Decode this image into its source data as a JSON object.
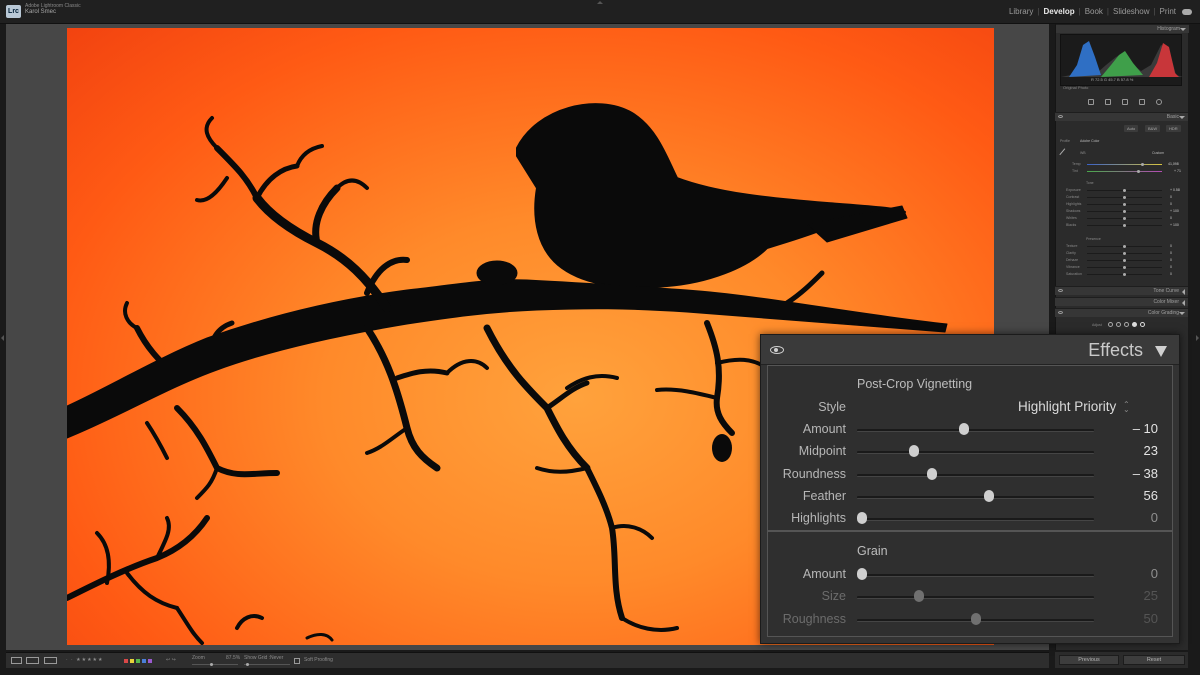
{
  "app": {
    "logo": "Lrc",
    "name": "Adobe Lightroom Classic",
    "user": "Karol Smec"
  },
  "modules": [
    {
      "label": "Library",
      "active": false
    },
    {
      "label": "Develop",
      "active": true
    },
    {
      "label": "Book",
      "active": false
    },
    {
      "label": "Slideshow",
      "active": false
    },
    {
      "label": "Print",
      "active": false
    }
  ],
  "right_panel": {
    "histogram_title": "Histogram",
    "histogram_values": "R  72.5   G  45.7   B  57.8  %",
    "original_photo": "Original Photo",
    "basic_title": "Basic",
    "basic_buttons": [
      "Auto",
      "B&W",
      "HDR"
    ],
    "profile_label": "Profile",
    "profile_value": "Adobe Color",
    "wb_label": "WB",
    "wb_value": "Custom",
    "temp_label": "Temp",
    "temp_value": "41,098",
    "tint_label": "Tint",
    "tint_value": "+ 71",
    "tone_label": "Tone",
    "tone_rows": [
      {
        "label": "Exposure",
        "value": "+ 0.58"
      },
      {
        "label": "Contrast",
        "value": "0"
      },
      {
        "label": "Highlights",
        "value": "0"
      },
      {
        "label": "Shadows",
        "value": "+ 100"
      },
      {
        "label": "Whites",
        "value": "0"
      },
      {
        "label": "Blacks",
        "value": "+ 100"
      }
    ],
    "presence_label": "Presence",
    "presence_rows": [
      {
        "label": "Texture",
        "value": "0"
      },
      {
        "label": "Clarity",
        "value": "0"
      },
      {
        "label": "Dehaze",
        "value": "0"
      },
      {
        "label": "Vibrance",
        "value": "0"
      },
      {
        "label": "Saturation",
        "value": "0"
      }
    ],
    "tone_curve_title": "Tone Curve",
    "color_mixer_title": "Color Mixer",
    "color_grading_title": "Color Grading",
    "adjust_label": "Adjust"
  },
  "effects": {
    "title": "Effects",
    "vignette_title": "Post-Crop Vignetting",
    "style_label": "Style",
    "style_value": "Highlight Priority",
    "vignette_sliders": [
      {
        "label": "Amount",
        "value": "– 10",
        "fraction": 0.45
      },
      {
        "label": "Midpoint",
        "value": "23",
        "fraction": 0.23
      },
      {
        "label": "Roundness",
        "value": "– 38",
        "fraction": 0.31
      },
      {
        "label": "Feather",
        "value": "56",
        "fraction": 0.56
      },
      {
        "label": "Highlights",
        "value": "0",
        "fraction": 0.0
      }
    ],
    "grain_title": "Grain",
    "grain_sliders": [
      {
        "label": "Amount",
        "value": "0",
        "fraction": 0.0
      },
      {
        "label": "Size",
        "value": "25",
        "fraction": 0.25
      },
      {
        "label": "Roughness",
        "value": "50",
        "fraction": 0.5
      }
    ]
  },
  "bottom": {
    "zoom_label": "Zoom",
    "zoom_value": "87.5%",
    "show_grid_label": "Show Grid :",
    "show_grid_value": "Never",
    "soft_proofing": "Soft Proofing",
    "previous_button": "Previous",
    "reset_button": "Reset"
  },
  "colors": {
    "sky_center": "#ffa23c",
    "sky_edge": "#f24310",
    "panel_bg": "#333333",
    "label_swatches": [
      "#d94848",
      "#e8d23a",
      "#55b84c",
      "#4a7fd9",
      "#9b5ad1"
    ]
  }
}
